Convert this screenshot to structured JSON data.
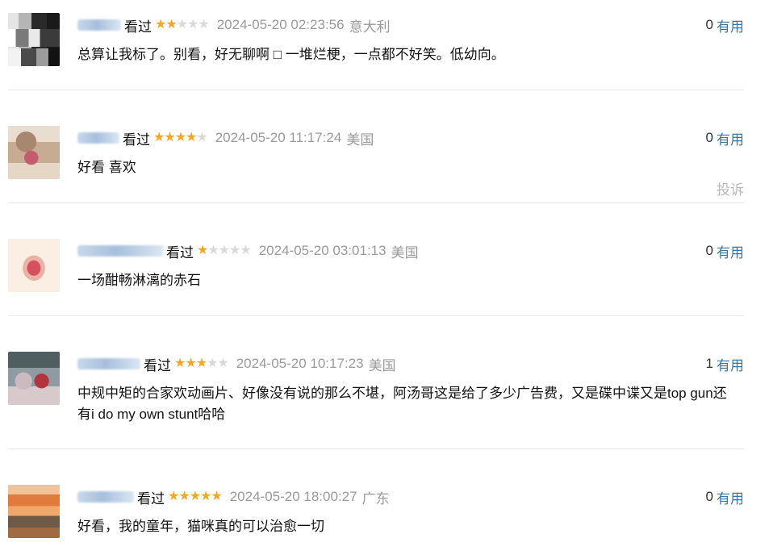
{
  "comments": [
    {
      "watched_label": "看过",
      "stars": 2,
      "time": "2024-05-20 02:23:56",
      "location": "意大利",
      "useful_count": "0",
      "useful_label": "有用",
      "text": "总算让我标了。别看，好无聊啊 □ 一堆烂梗，一点都不好笑。低幼向。",
      "avatar_colors": [
        "#1a1a1a",
        "#6d6d6d",
        "#c9c9c9",
        "#2c2c2c"
      ]
    },
    {
      "watched_label": "看过",
      "stars": 4,
      "time": "2024-05-20 11:17:24",
      "location": "美国",
      "useful_count": "0",
      "useful_label": "有用",
      "text": "好看 喜欢",
      "report_label": "投诉",
      "avatar_colors": [
        "#c9b49a",
        "#b28a74",
        "#c76a7a",
        "#e8dccd"
      ]
    },
    {
      "watched_label": "看过",
      "stars": 1,
      "time": "2024-05-20 03:01:13",
      "location": "美国",
      "useful_count": "0",
      "useful_label": "有用",
      "text": "一场酣畅淋漓的赤石",
      "avatar_colors": [
        "#f7e3d3",
        "#eab9a8",
        "#d85060",
        "#f5d8c6"
      ]
    },
    {
      "watched_label": "看过",
      "stars": 3,
      "time": "2024-05-20 10:17:23",
      "location": "美国",
      "useful_count": "1",
      "useful_label": "有用",
      "text": "中规中矩的合家欢动画片、好像没有说的那么不堪，阿汤哥这是给了多少广告费，又是碟中谍又是top gun还有i do my own stunt哈哈",
      "avatar_colors": [
        "#5a6a6a",
        "#c9b6bb",
        "#b33a3f",
        "#8e9aa2"
      ]
    },
    {
      "watched_label": "看过",
      "stars": 5,
      "time": "2024-05-20 18:00:27",
      "location": "广东",
      "useful_count": "0",
      "useful_label": "有用",
      "text": "好看，我的童年，猫咪真的可以治愈一切",
      "avatar_colors": [
        "#d47a3a",
        "#f0b27a",
        "#6b5a4a",
        "#a36b45"
      ]
    }
  ]
}
